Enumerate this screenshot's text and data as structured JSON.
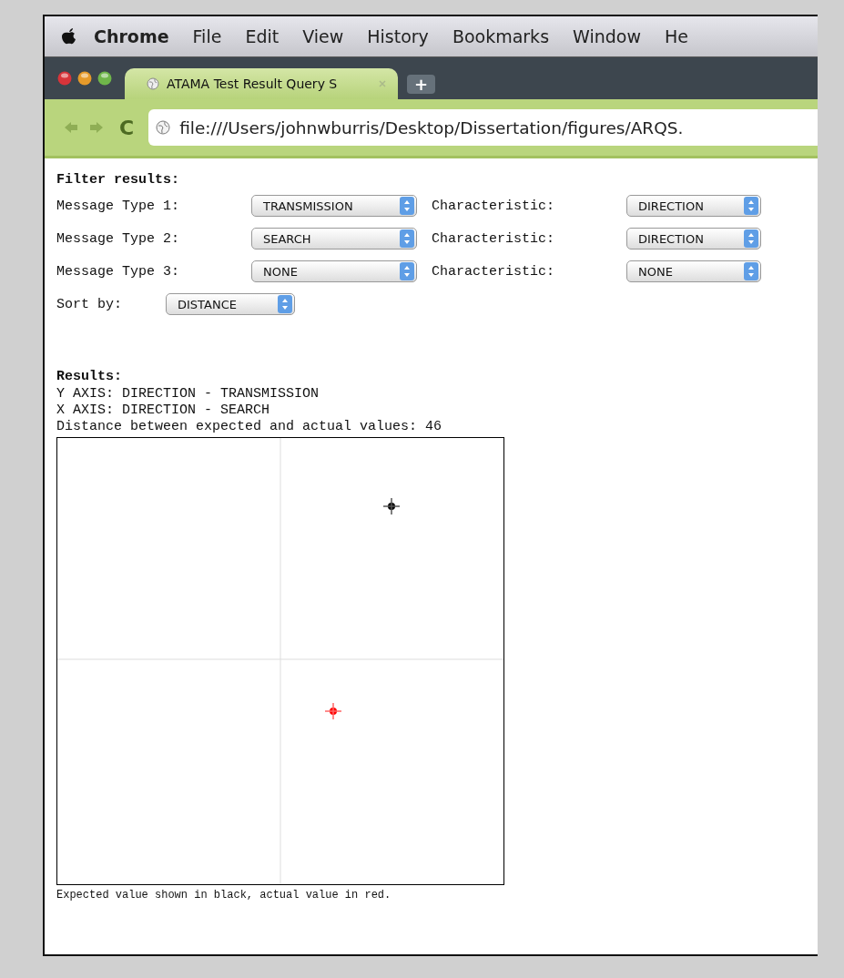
{
  "menu_bar": {
    "app": "Chrome",
    "items": [
      "File",
      "Edit",
      "View",
      "History",
      "Bookmarks",
      "Window",
      "He"
    ]
  },
  "tab": {
    "title": "ATAMA Test Result Query S",
    "new_tab": "+"
  },
  "address_bar": {
    "reload": "C",
    "url": "file:///Users/johnwburris/Desktop/Dissertation/figures/ARQS."
  },
  "filter": {
    "heading": "Filter results:",
    "rows": [
      {
        "label": "Message Type 1:",
        "value": "TRANSMISSION",
        "char_label": "Characteristic:",
        "char_value": "DIRECTION"
      },
      {
        "label": "Message Type 2:",
        "value": "SEARCH",
        "char_label": "Characteristic:",
        "char_value": "DIRECTION"
      },
      {
        "label": "Message Type 3:",
        "value": "NONE",
        "char_label": "Characteristic:",
        "char_value": "NONE"
      }
    ],
    "sort": {
      "label": "Sort by:",
      "value": "DISTANCE"
    }
  },
  "results": {
    "heading": "Results:",
    "lines": [
      "Y AXIS: DIRECTION - TRANSMISSION",
      "X AXIS: DIRECTION - SEARCH",
      "Distance between expected and actual values: 46"
    ],
    "caption": "Expected value shown in black, actual value in red."
  }
}
